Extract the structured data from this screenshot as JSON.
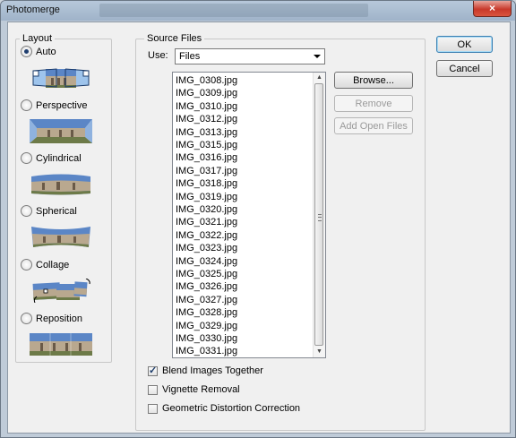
{
  "window": {
    "title": "Photomerge",
    "close_glyph": "×"
  },
  "layout": {
    "legend": "Layout",
    "options": [
      {
        "label": "Auto",
        "selected": true,
        "icon": "auto-layout-icon"
      },
      {
        "label": "Perspective",
        "selected": false,
        "icon": "perspective-layout-icon"
      },
      {
        "label": "Cylindrical",
        "selected": false,
        "icon": "cylindrical-layout-icon"
      },
      {
        "label": "Spherical",
        "selected": false,
        "icon": "spherical-layout-icon"
      },
      {
        "label": "Collage",
        "selected": false,
        "icon": "collage-layout-icon"
      },
      {
        "label": "Reposition",
        "selected": false,
        "icon": "reposition-layout-icon"
      }
    ]
  },
  "source": {
    "legend": "Source Files",
    "use_label": "Use:",
    "use_value": "Files",
    "files": [
      "IMG_0308.jpg",
      "IMG_0309.jpg",
      "IMG_0310.jpg",
      "IMG_0312.jpg",
      "IMG_0313.jpg",
      "IMG_0315.jpg",
      "IMG_0316.jpg",
      "IMG_0317.jpg",
      "IMG_0318.jpg",
      "IMG_0319.jpg",
      "IMG_0320.jpg",
      "IMG_0321.jpg",
      "IMG_0322.jpg",
      "IMG_0323.jpg",
      "IMG_0324.jpg",
      "IMG_0325.jpg",
      "IMG_0326.jpg",
      "IMG_0327.jpg",
      "IMG_0328.jpg",
      "IMG_0329.jpg",
      "IMG_0330.jpg",
      "IMG_0331.jpg"
    ],
    "browse_label": "Browse...",
    "remove_label": "Remove",
    "add_open_label": "Add Open Files"
  },
  "options": [
    {
      "label": "Blend Images Together",
      "checked": true
    },
    {
      "label": "Vignette Removal",
      "checked": false
    },
    {
      "label": "Geometric Distortion Correction",
      "checked": false
    }
  ],
  "actions": {
    "ok_label": "OK",
    "cancel_label": "Cancel"
  },
  "colors": {
    "sky": "#5b86c6",
    "building": "#b9a88f",
    "ground": "#6d7a48"
  }
}
